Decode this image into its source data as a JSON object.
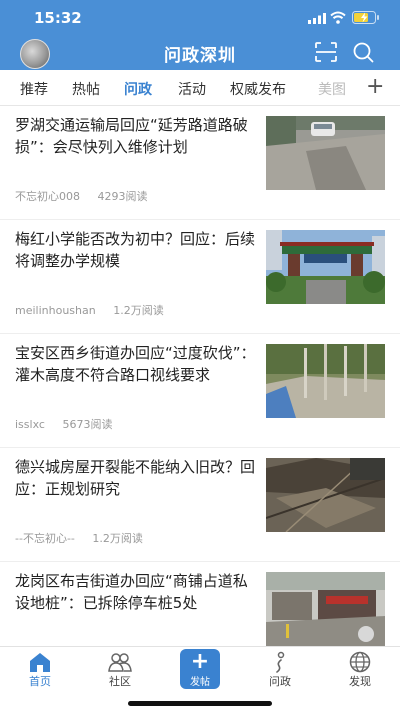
{
  "status": {
    "time": "15:32"
  },
  "header": {
    "title": "问政深圳"
  },
  "tabs": [
    {
      "label": "推荐"
    },
    {
      "label": "热帖"
    },
    {
      "label": "问政"
    },
    {
      "label": "活动"
    },
    {
      "label": "权威发布"
    },
    {
      "label": "美图"
    }
  ],
  "active_tab": "问政",
  "articles": [
    {
      "title": "罗湖交通运输局回应“延芳路道路破损”：会尽快列入维修计划",
      "author": "不忘初心008",
      "views": "4293阅读"
    },
    {
      "title": "梅红小学能否改为初中？回应：后续将调整办学规模",
      "author": "meilinhoushan",
      "views": "1.2万阅读"
    },
    {
      "title": "宝安区西乡街道办回应“过度砍伐”：灌木高度不符合路口视线要求",
      "author": "isslxc",
      "views": "5673阅读"
    },
    {
      "title": "德兴城房屋开裂能不能纳入旧改？回应：正规划研究",
      "author": "--不忘初心--",
      "views": "1.2万阅读"
    },
    {
      "title": "龙岗区布吉街道办回应“商铺占道私设地桩”：已拆除停车桩5处",
      "author": "",
      "views": ""
    }
  ],
  "bottom_nav": [
    {
      "label": "首页",
      "icon": "home-icon"
    },
    {
      "label": "社区",
      "icon": "community-icon"
    },
    {
      "label": "发帖",
      "icon": "plus-icon"
    },
    {
      "label": "问政",
      "icon": "inquiry-icon"
    },
    {
      "label": "发现",
      "icon": "globe-icon"
    }
  ],
  "colors": {
    "accent": "#3a82d0",
    "header": "#4a8fd6"
  }
}
